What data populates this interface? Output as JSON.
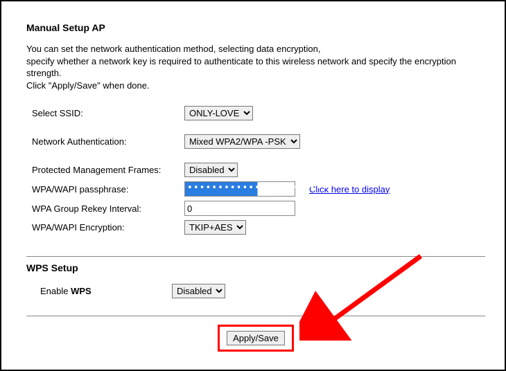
{
  "title": "Manual Setup AP",
  "intro_lines": [
    "You can set the network authentication method, selecting data encryption,",
    "specify whether a network key is required to authenticate to this wireless network and specify the encryption strength.",
    "Click \"Apply/Save\" when done."
  ],
  "form": {
    "ssid_label": "Select SSID:",
    "ssid_value": "ONLY-LOVE",
    "auth_label": "Network Authentication:",
    "auth_value": "Mixed WPA2/WPA -PSK",
    "pmf_label": "Protected Management Frames:",
    "pmf_value": "Disabled",
    "passphrase_label": "WPA/WAPI passphrase:",
    "passphrase_mask": "••••••••••••••••••••••••",
    "display_link": "Click here to display",
    "rekey_label": "WPA Group Rekey Interval:",
    "rekey_value": "0",
    "enc_label": "WPA/WAPI Encryption:",
    "enc_value": "TKIP+AES"
  },
  "wps": {
    "heading": "WPS Setup",
    "enable_label_a": "Enable ",
    "enable_label_b": "WPS",
    "enable_value": "Disabled"
  },
  "submit": {
    "apply_label": "Apply/Save"
  },
  "accent": {
    "highlight": "#ff0000"
  }
}
